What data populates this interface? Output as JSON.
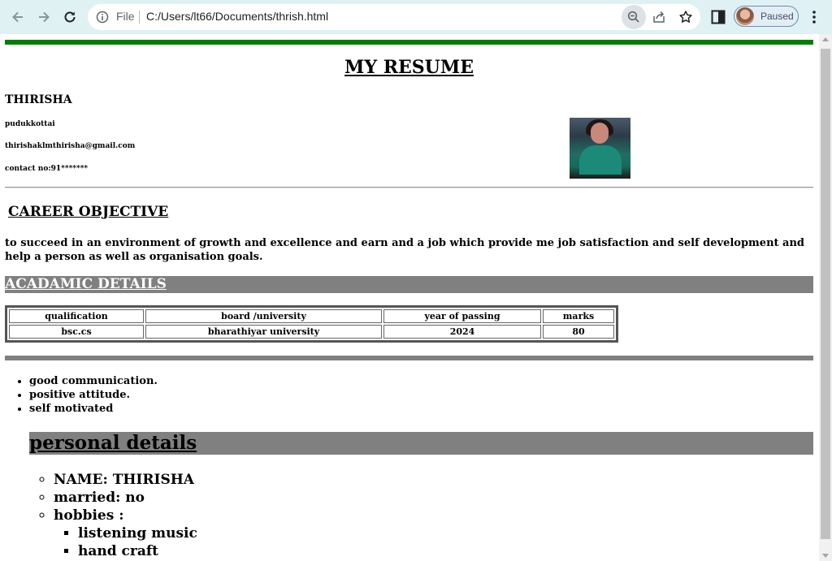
{
  "browser": {
    "file_label": "File",
    "url": "C:/Users/lt66/Documents/thrish.html",
    "profile_status": "Paused"
  },
  "resume": {
    "title": "MY RESUME",
    "name": "THIRISHA",
    "location": "pudukkottai",
    "email": "thirishaklmthirisha@gmail.com",
    "contact": "contact no:91*******",
    "career_heading": "CAREER OBJECTIVE",
    "objective": "to succeed in an environment of growth and excellence and earn and a job which provide me job satisfaction and self development and help a person as well as organisation goals.",
    "academic_heading": "ACADAMIC DETAILS",
    "table": {
      "headers": [
        "qualification",
        "board /university",
        "year of passing",
        "marks"
      ],
      "rows": [
        [
          "bsc.cs",
          "bharathiyar university",
          "2024",
          "80"
        ]
      ]
    },
    "skills": [
      "good communication.",
      "positive attitude.",
      "self motivated"
    ],
    "personal_heading": "personal details",
    "personal": {
      "name": "NAME: THIRISHA",
      "married": "married: no",
      "hobbies_label": "hobbies :",
      "hobbies": [
        "listening music",
        "hand craft"
      ]
    }
  }
}
